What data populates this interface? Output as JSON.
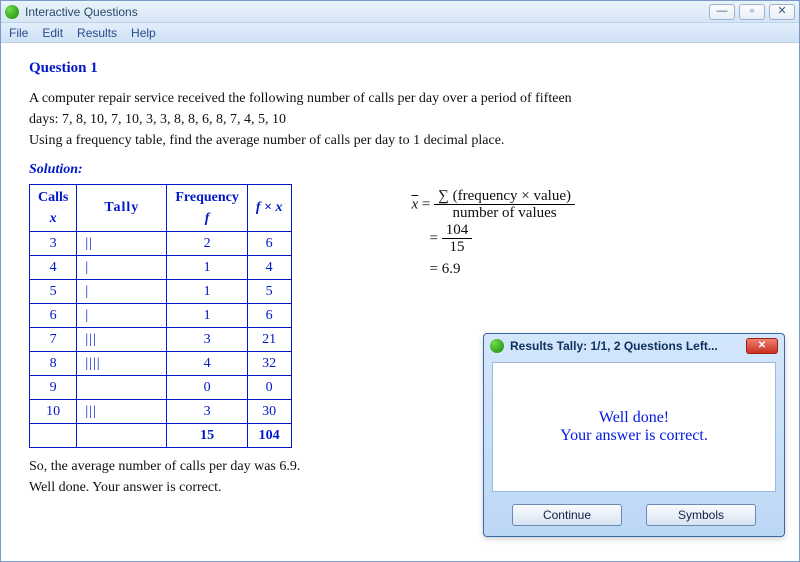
{
  "window": {
    "title": "Interactive Questions",
    "controls": {
      "minimize": "—",
      "maximize": "▫",
      "close": "✕"
    }
  },
  "menubar": [
    "File",
    "Edit",
    "Results",
    "Help"
  ],
  "question": {
    "title": "Question 1",
    "prompt_line1": "A computer repair service received the following number of calls per day over a period of fifteen",
    "prompt_line2": "days:    7, 8, 10, 7, 10, 3, 3, 8, 8, 6, 8, 7, 4, 5, 10",
    "prompt_line3": "Using a frequency table, find the average number of calls per day to 1 decimal place.",
    "solution_label": "Solution:"
  },
  "table": {
    "headers": {
      "calls": "Calls",
      "calls_sub": "x",
      "tally": "Tally",
      "freq": "Frequency",
      "freq_sub": "f",
      "fx": "f × x"
    },
    "rows": [
      {
        "x": "3",
        "tally": "||",
        "f": "2",
        "fx": "6"
      },
      {
        "x": "4",
        "tally": "|",
        "f": "1",
        "fx": "4"
      },
      {
        "x": "5",
        "tally": "|",
        "f": "1",
        "fx": "5"
      },
      {
        "x": "6",
        "tally": "|",
        "f": "1",
        "fx": "6"
      },
      {
        "x": "7",
        "tally": "|||",
        "f": "3",
        "fx": "21"
      },
      {
        "x": "8",
        "tally": "||||",
        "f": "4",
        "fx": "32"
      },
      {
        "x": "9",
        "tally": "",
        "f": "0",
        "fx": "0"
      },
      {
        "x": "10",
        "tally": "|||",
        "f": "3",
        "fx": "30"
      }
    ],
    "totals": {
      "f": "15",
      "fx": "104"
    }
  },
  "calc": {
    "mean_sym": "x",
    "eq": "=",
    "formula_num": "∑ (frequency × value)",
    "formula_den": "number of values",
    "step_num": "104",
    "step_den": "15",
    "result": "= 6.9"
  },
  "after": {
    "line1": "So, the average number of calls per day was 6.9.",
    "line2": "Well done.  Your answer is correct."
  },
  "dialog": {
    "title": "Results Tally: 1/1, 2 Questions Left...",
    "line1": "Well done!",
    "line2": "Your answer is correct.",
    "continue": "Continue",
    "symbols": "Symbols"
  }
}
